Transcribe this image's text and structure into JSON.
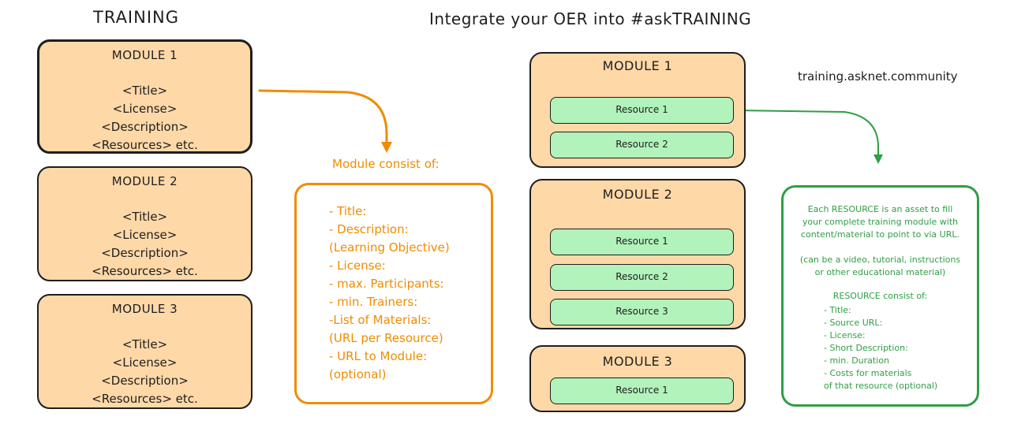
{
  "left_title": "TRAINING",
  "right_title": "Integrate your OER into #askTRAINING",
  "site_url": "training.asknet.community",
  "left_modules": [
    {
      "name": "MODULE 1",
      "fields": [
        "<Title>",
        "<License>",
        "<Description>",
        "<Resources> etc."
      ]
    },
    {
      "name": "MODULE 2",
      "fields": [
        "<Title>",
        "<License>",
        "<Description>",
        "<Resources> etc."
      ]
    },
    {
      "name": "MODULE 3",
      "fields": [
        "<Title>",
        "<License>",
        "<Description>",
        "<Resources> etc."
      ]
    }
  ],
  "module_consist": {
    "heading": "Module consist of:",
    "lines": [
      "- Title:",
      "- Description:",
      "(Learning Objective)",
      "- License:",
      "- max. Participants:",
      "- min. Trainers:",
      "-List of Materials:",
      "(URL per Resource)",
      "- URL to Module:",
      "(optional)"
    ]
  },
  "right_modules": [
    {
      "name": "MODULE 1",
      "resources": [
        "Resource 1",
        "Resource 2"
      ]
    },
    {
      "name": "MODULE 2",
      "resources": [
        "Resource 1",
        "Resource 2",
        "Resource 3"
      ]
    },
    {
      "name": "MODULE 3",
      "resources": [
        "Resource 1"
      ]
    }
  ],
  "resource_info": {
    "intro": [
      "Each RESOURCE is an asset to fill",
      "your complete training module with",
      "content/material to point to via URL."
    ],
    "note": [
      "(can be a video, tutorial, instructions",
      "or other educational material)"
    ],
    "heading": "RESOURCE consist of:",
    "lines": [
      "- Title:",
      "- Source URL:",
      "- License:",
      "- Short Description:",
      "- min. Duration",
      "- Costs for materials",
      "of that resource (optional)"
    ]
  },
  "colors": {
    "module_fill": "#ffd8a8",
    "resource_fill": "#b2f2bb",
    "orange_accent": "#f08c00",
    "green_accent": "#2f9e44",
    "stroke": "#1e1e1e"
  }
}
